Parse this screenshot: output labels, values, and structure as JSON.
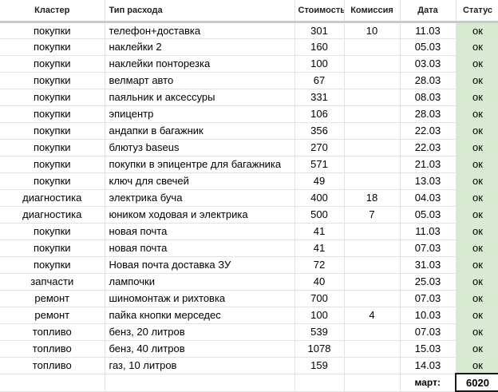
{
  "headers": {
    "cluster": "Кластер",
    "type": "Тип расхода",
    "cost": "Стоимость",
    "commission": "Комиссия",
    "date": "Дата",
    "status": "Статус"
  },
  "rows": [
    {
      "cluster": "покупки",
      "type": "телефон+доставка",
      "cost": "301",
      "commission": "10",
      "date": "11.03",
      "status": "ок"
    },
    {
      "cluster": "покупки",
      "type": "наклейки 2",
      "cost": "160",
      "commission": "",
      "date": "05.03",
      "status": "ок"
    },
    {
      "cluster": "покупки",
      "type": "наклейки понторезка",
      "cost": "100",
      "commission": "",
      "date": "03.03",
      "status": "ок"
    },
    {
      "cluster": "покупки",
      "type": "велмарт авто",
      "cost": "67",
      "commission": "",
      "date": "28.03",
      "status": "ок"
    },
    {
      "cluster": "покупки",
      "type": "паяльник и аксессуры",
      "cost": "331",
      "commission": "",
      "date": "08.03",
      "status": "ок"
    },
    {
      "cluster": "покупки",
      "type": "эпицентр",
      "cost": "106",
      "commission": "",
      "date": "28.03",
      "status": "ок"
    },
    {
      "cluster": "покупки",
      "type": "андапки в багажник",
      "cost": "356",
      "commission": "",
      "date": "22.03",
      "status": "ок"
    },
    {
      "cluster": "покупки",
      "type": "блютуз baseus",
      "cost": "270",
      "commission": "",
      "date": "22.03",
      "status": "ок"
    },
    {
      "cluster": "покупки",
      "type": "покупки в эпицентре для багажника",
      "cost": "571",
      "commission": "",
      "date": "21.03",
      "status": "ок"
    },
    {
      "cluster": "покупки",
      "type": "ключ для свечей",
      "cost": "49",
      "commission": "",
      "date": "13.03",
      "status": "ок"
    },
    {
      "cluster": "диагностика",
      "type": "электрика буча",
      "cost": "400",
      "commission": "18",
      "date": "04.03",
      "status": "ок"
    },
    {
      "cluster": "диагностика",
      "type": "юником ходовая и электрика",
      "cost": "500",
      "commission": "7",
      "date": "05.03",
      "status": "ок"
    },
    {
      "cluster": "покупки",
      "type": "новая почта",
      "cost": "41",
      "commission": "",
      "date": "11.03",
      "status": "ок"
    },
    {
      "cluster": "покупки",
      "type": "новая почта",
      "cost": "41",
      "commission": "",
      "date": "07.03",
      "status": "ок"
    },
    {
      "cluster": "покупки",
      "type": "Новая почта доставка ЗУ",
      "cost": "72",
      "commission": "",
      "date": "31.03",
      "status": "ок"
    },
    {
      "cluster": "запчасти",
      "type": "лампочки",
      "cost": "40",
      "commission": "",
      "date": "25.03",
      "status": "ок"
    },
    {
      "cluster": "ремонт",
      "type": "шиномонтаж и рихтовка",
      "cost": "700",
      "commission": "",
      "date": "07.03",
      "status": "ок"
    },
    {
      "cluster": "ремонт",
      "type": "пайка кнопки мерседес",
      "cost": "100",
      "commission": "4",
      "date": "10.03",
      "status": "ок"
    },
    {
      "cluster": "топливо",
      "type": "бенз, 20 литров",
      "cost": "539",
      "commission": "",
      "date": "07.03",
      "status": "ок"
    },
    {
      "cluster": "топливо",
      "type": "бенз, 40 литров",
      "cost": "1078",
      "commission": "",
      "date": "15.03",
      "status": "ок"
    },
    {
      "cluster": "топливо",
      "type": "газ, 10 литров",
      "cost": "159",
      "commission": "",
      "date": "14.03",
      "status": "ок"
    }
  ],
  "total": {
    "label": "март:",
    "value": "6020"
  },
  "colors": {
    "status_ok_bg": "#d9ead3",
    "grid": "#e2e2e2",
    "header_rule": "#c9c9c9"
  }
}
